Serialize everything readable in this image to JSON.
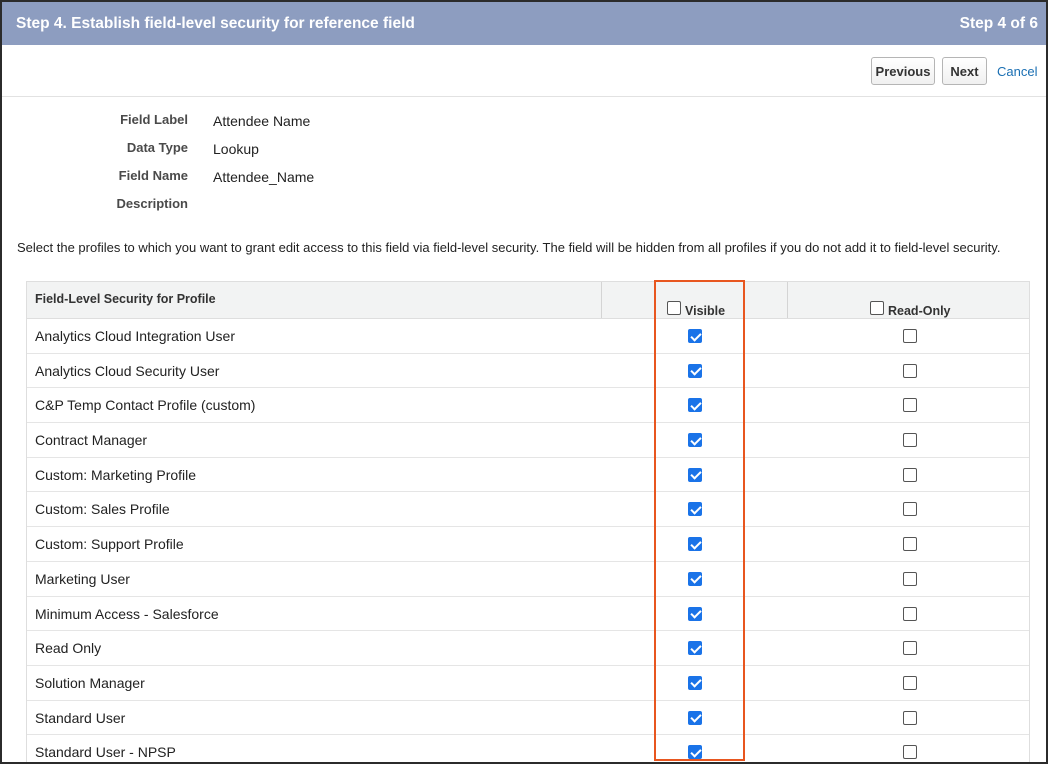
{
  "header": {
    "title": "Step 4. Establish field-level security for reference field",
    "step": "Step 4 of 6"
  },
  "toolbar": {
    "previous_label": "Previous",
    "next_label": "Next",
    "cancel_label": "Cancel"
  },
  "details": [
    {
      "label": "Field Label",
      "value": "Attendee Name"
    },
    {
      "label": "Data Type",
      "value": "Lookup"
    },
    {
      "label": "Field Name",
      "value": "Attendee_Name"
    },
    {
      "label": "Description",
      "value": ""
    }
  ],
  "instructions": "Select the profiles to which you want to grant edit access to this field via field-level security. The field will be hidden from all profiles if you do not add it to field-level security.",
  "table": {
    "columns": {
      "profile": "Field-Level Security for Profile",
      "visible": "Visible",
      "read_only": "Read-Only"
    },
    "rows": [
      {
        "profile": "Analytics Cloud Integration User",
        "visible": true,
        "read_only": false
      },
      {
        "profile": "Analytics Cloud Security User",
        "visible": true,
        "read_only": false
      },
      {
        "profile": "C&P Temp Contact Profile (custom)",
        "visible": true,
        "read_only": false
      },
      {
        "profile": "Contract Manager",
        "visible": true,
        "read_only": false
      },
      {
        "profile": "Custom: Marketing Profile",
        "visible": true,
        "read_only": false
      },
      {
        "profile": "Custom: Sales Profile",
        "visible": true,
        "read_only": false
      },
      {
        "profile": "Custom: Support Profile",
        "visible": true,
        "read_only": false
      },
      {
        "profile": "Marketing User",
        "visible": true,
        "read_only": false
      },
      {
        "profile": "Minimum Access - Salesforce",
        "visible": true,
        "read_only": false
      },
      {
        "profile": "Read Only",
        "visible": true,
        "read_only": false
      },
      {
        "profile": "Solution Manager",
        "visible": true,
        "read_only": false
      },
      {
        "profile": "Standard User",
        "visible": true,
        "read_only": false
      },
      {
        "profile": "Standard User - NPSP",
        "visible": true,
        "read_only": false
      }
    ]
  },
  "colors": {
    "header_bg": "#8d9dc0",
    "highlight": "#e8561f",
    "checkbox_checked": "#1a73e8",
    "link": "#1a6fb3"
  }
}
